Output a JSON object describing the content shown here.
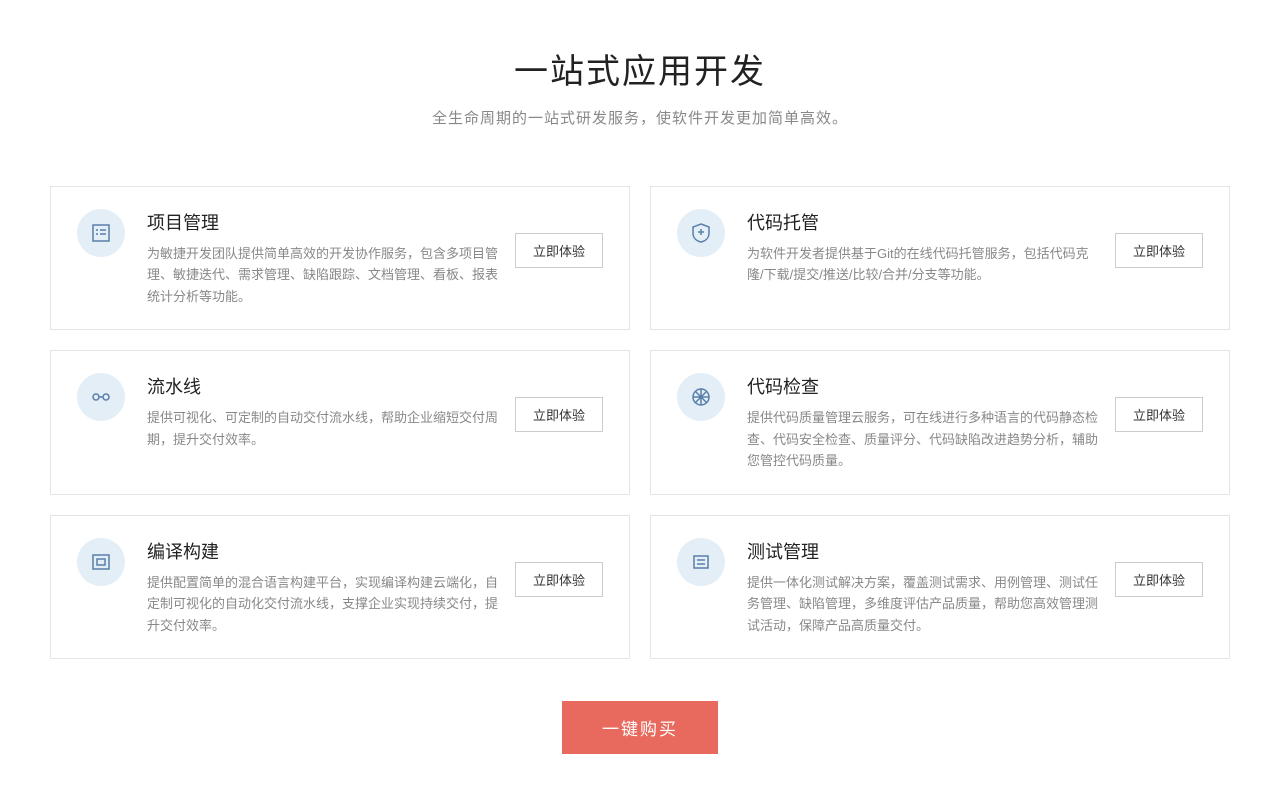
{
  "header": {
    "title": "一站式应用开发",
    "subtitle": "全生命周期的一站式研发服务，使软件开发更加简单高效。"
  },
  "cards": [
    {
      "title": "项目管理",
      "desc": "为敏捷开发团队提供简单高效的开发协作服务，包含多项目管理、敏捷迭代、需求管理、缺陷跟踪、文档管理、看板、报表统计分析等功能。",
      "button": "立即体验",
      "icon": "list"
    },
    {
      "title": "代码托管",
      "desc": "为软件开发者提供基于Git的在线代码托管服务，包括代码克隆/下载/提交/推送/比较/合并/分支等功能。",
      "button": "立即体验",
      "icon": "shield"
    },
    {
      "title": "流水线",
      "desc": "提供可视化、可定制的自动交付流水线，帮助企业缩短交付周期，提升交付效率。",
      "button": "立即体验",
      "icon": "pipeline"
    },
    {
      "title": "代码检查",
      "desc": "提供代码质量管理云服务，可在线进行多种语言的代码静态检查、代码安全检查、质量评分、代码缺陷改进趋势分析，辅助您管控代码质量。",
      "button": "立即体验",
      "icon": "scan"
    },
    {
      "title": "编译构建",
      "desc": "提供配置简单的混合语言构建平台，实现编译构建云端化，自定制可视化的自动化交付流水线，支撑企业实现持续交付，提升交付效率。",
      "button": "立即体验",
      "icon": "build"
    },
    {
      "title": "测试管理",
      "desc": "提供一体化测试解决方案，覆盖测试需求、用例管理、测试任务管理、缺陷管理，多维度评估产品质量，帮助您高效管理测试活动，保障产品高质量交付。",
      "button": "立即体验",
      "icon": "test"
    }
  ],
  "footer": {
    "buy_label": "一键购买"
  }
}
